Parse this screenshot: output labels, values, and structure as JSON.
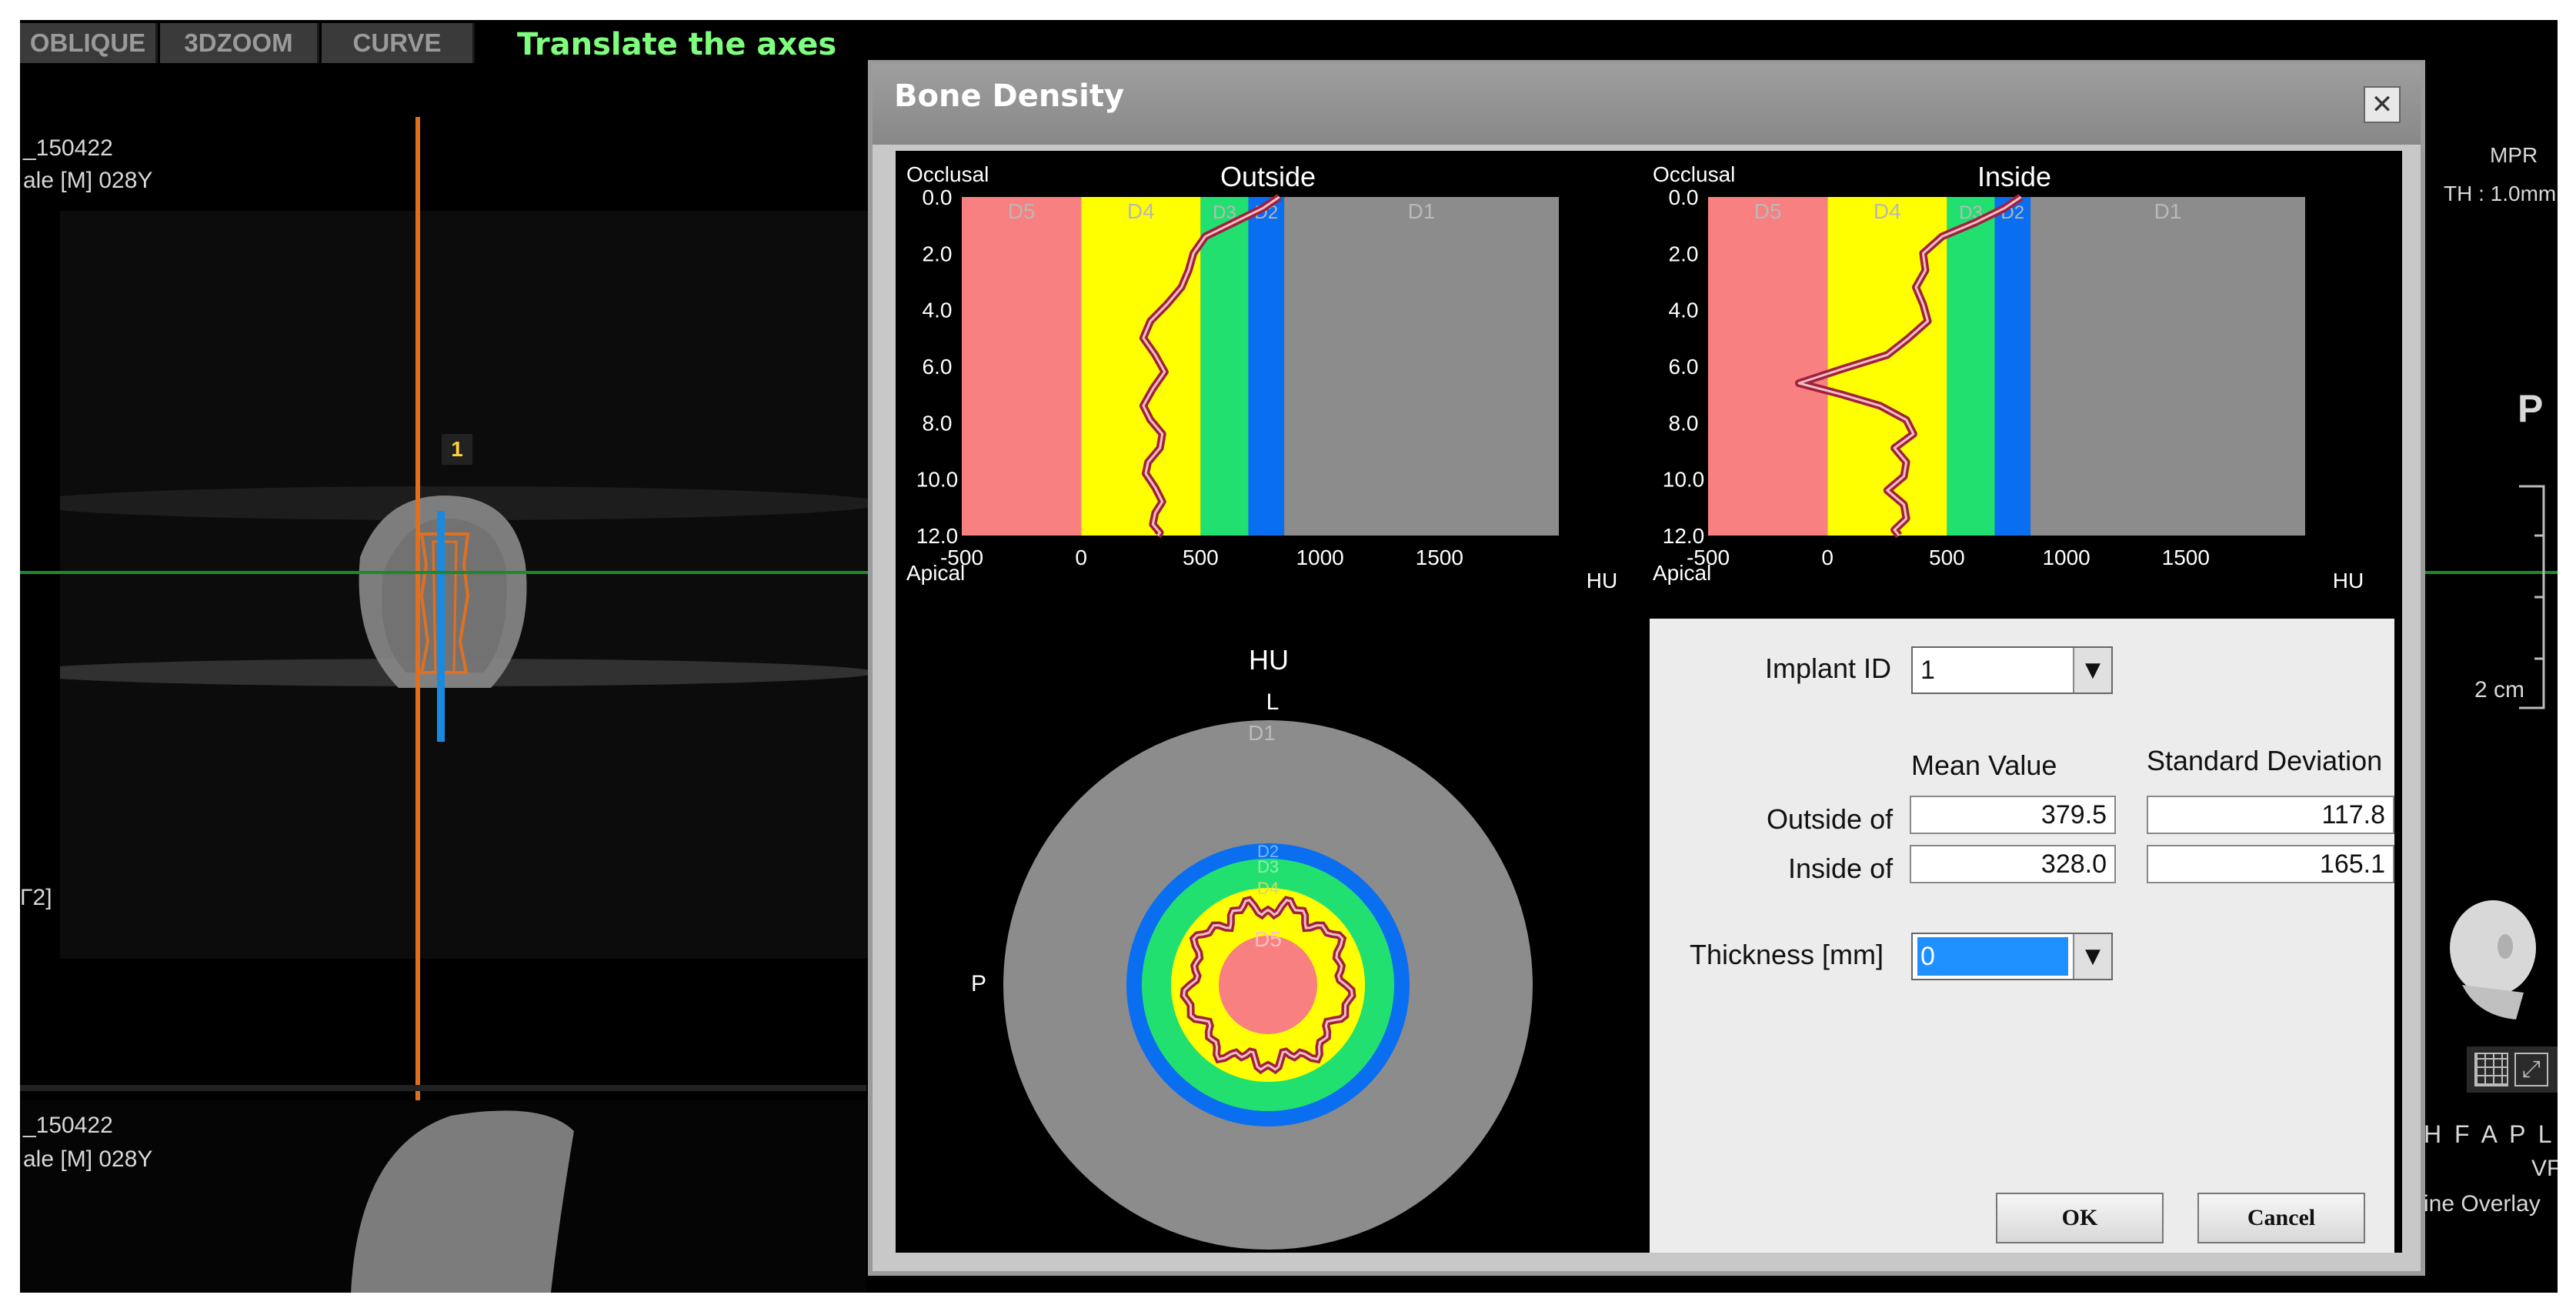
{
  "toolbar": {
    "tabs": [
      "OBLIQUE",
      "3DZOOM",
      "CURVE"
    ],
    "title": "Translate the axes"
  },
  "viewer": {
    "top_left": {
      "line1": "_150422",
      "line2": "ale  [M] 028Y"
    },
    "bottom_left": {
      "line1": "_150422",
      "line2": "ale  [M] 028Y"
    },
    "left_mid": "Γ2]",
    "implant_marker": "1",
    "right_top": {
      "line1": "MPR",
      "line2": "TH : 1.0mm"
    },
    "orientation_p": "P",
    "scale": "2 cm",
    "orientation_letters": "H F A P L R",
    "vr_label": "VF",
    "overlay_label": "ine Overlay"
  },
  "dialog": {
    "title": "Bone Density",
    "close_glyph": "✕",
    "outside_chart": {
      "title": "Outside",
      "top_label": "Occlusal",
      "bottom_label": "Apical",
      "unit": "HU"
    },
    "inside_chart": {
      "title": "Inside",
      "top_label": "Occlusal",
      "bottom_label": "Apical",
      "unit": "HU"
    },
    "radial": {
      "unit": "HU",
      "top_label": "L",
      "left_label": "P",
      "zone_labels": [
        "D1",
        "D2",
        "D3",
        "D4",
        "D5"
      ]
    },
    "form": {
      "implant_id_label": "Implant ID",
      "implant_id_value": "1",
      "mean_header": "Mean Value",
      "sd_header": "Standard Deviation",
      "outside_label": "Outside of",
      "outside_mean": "379.5",
      "outside_sd": "117.8",
      "inside_label": "Inside of",
      "inside_mean": "328.0",
      "inside_sd": "165.1",
      "thickness_label": "Thickness [mm]",
      "thickness_value": "0",
      "ok_label": "OK",
      "cancel_label": "Cancel"
    }
  },
  "colors": {
    "D5": "#f88080",
    "D4": "#ffff00",
    "D3": "#22e070",
    "D2": "#0a6ef0",
    "D1": "#8c8c8c",
    "profile": "#a02040",
    "accent_title": "#7dff7d",
    "crosshair_v": "#e07020",
    "crosshair_h": "#1a8a2a"
  },
  "chart_data": [
    {
      "type": "line",
      "title": "Outside",
      "xlabel": "HU",
      "ylabel": "",
      "xlim": [
        -500,
        2000
      ],
      "ylim": [
        0,
        12
      ],
      "y_inverted": true,
      "x_ticks": [
        -500,
        0,
        500,
        1000,
        1500
      ],
      "y_ticks": [
        0.0,
        2.0,
        4.0,
        6.0,
        8.0,
        10.0,
        12.0
      ],
      "bands": [
        {
          "name": "D5",
          "from": -500,
          "to": 0
        },
        {
          "name": "D4",
          "from": 0,
          "to": 500
        },
        {
          "name": "D3",
          "from": 500,
          "to": 700
        },
        {
          "name": "D2",
          "from": 700,
          "to": 850
        },
        {
          "name": "D1",
          "from": 850,
          "to": 2000
        }
      ],
      "series": [
        {
          "x": [
            830,
            760,
            640,
            520,
            470,
            450,
            420,
            360,
            290,
            260,
            310,
            350,
            300,
            260,
            290,
            340,
            330,
            280,
            270,
            310,
            340,
            310,
            300,
            330,
            320
          ],
          "y": [
            0,
            0.4,
            0.9,
            1.4,
            2.0,
            2.6,
            3.2,
            3.8,
            4.4,
            5.0,
            5.6,
            6.2,
            6.8,
            7.4,
            7.9,
            8.4,
            8.9,
            9.4,
            9.8,
            10.3,
            10.8,
            11.2,
            11.6,
            11.9,
            12.0
          ]
        }
      ]
    },
    {
      "type": "line",
      "title": "Inside",
      "xlabel": "HU",
      "ylabel": "",
      "xlim": [
        -500,
        2000
      ],
      "ylim": [
        0,
        12
      ],
      "y_inverted": true,
      "x_ticks": [
        -500,
        0,
        500,
        1000,
        1500
      ],
      "y_ticks": [
        0.0,
        2.0,
        4.0,
        6.0,
        8.0,
        10.0,
        12.0
      ],
      "bands": [
        {
          "name": "D5",
          "from": -500,
          "to": 0
        },
        {
          "name": "D4",
          "from": 0,
          "to": 500
        },
        {
          "name": "D3",
          "from": 500,
          "to": 700
        },
        {
          "name": "D2",
          "from": 700,
          "to": 850
        },
        {
          "name": "D1",
          "from": 850,
          "to": 2000
        }
      ],
      "series": [
        {
          "x": [
            810,
            740,
            620,
            480,
            400,
            410,
            370,
            400,
            420,
            340,
            250,
            60,
            -120,
            60,
            220,
            330,
            360,
            280,
            330,
            320,
            250,
            320,
            330,
            280,
            300
          ],
          "y": [
            0,
            0.4,
            0.9,
            1.4,
            2.0,
            2.6,
            3.2,
            3.8,
            4.4,
            5.0,
            5.6,
            6.1,
            6.6,
            7.0,
            7.4,
            7.9,
            8.4,
            8.9,
            9.4,
            9.9,
            10.4,
            10.9,
            11.4,
            11.8,
            12.0
          ]
        }
      ]
    }
  ]
}
